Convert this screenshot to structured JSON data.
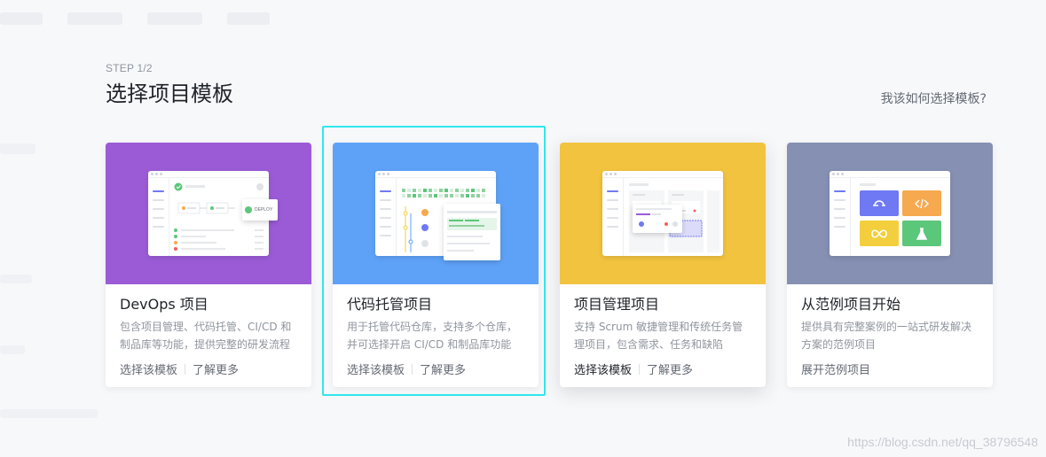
{
  "header": {
    "step": "STEP 1/2",
    "title": "选择项目模板",
    "help_link": "我该如何选择模板?"
  },
  "cards": [
    {
      "title": "DevOps 项目",
      "desc": "包含项目管理、代码托管、CI/CD 和制品库等功能，提供完整的研发流程",
      "action_primary": "选择该模板",
      "action_secondary": "了解更多",
      "hero_color": "#9b5bd6",
      "deploy_label": "DEPLOY"
    },
    {
      "title": "代码托管项目",
      "desc": "用于托管代码仓库，支持多个仓库，并可选择开启 CI/CD 和制品库功能",
      "action_primary": "选择该模板",
      "action_secondary": "了解更多",
      "hero_color": "#5ea2f8"
    },
    {
      "title": "项目管理项目",
      "desc": "支持 Scrum 敏捷管理和传统任务管理项目，包含需求、任务和缺陷",
      "action_primary": "选择该模板",
      "action_secondary": "了解更多",
      "hero_color": "#f2c33f"
    },
    {
      "title": "从范例项目开始",
      "desc": "提供具有完整案例的一站式研发解决方案的范例项目",
      "action_primary": "展开范例项目",
      "hero_color": "#8690b2"
    }
  ],
  "watermark": "https://blog.csdn.net/qq_38796548",
  "colors": {
    "selected_outline": "#2ee8ec",
    "tile_blue": "#6f79f3",
    "tile_orange": "#f6a94e",
    "tile_yellow": "#f4cf3d",
    "tile_green": "#5bc77a"
  },
  "icons": {
    "tile_1": "loop-icon",
    "tile_2": "code-icon",
    "tile_3": "infinity-icon",
    "tile_4": "flask-icon"
  }
}
